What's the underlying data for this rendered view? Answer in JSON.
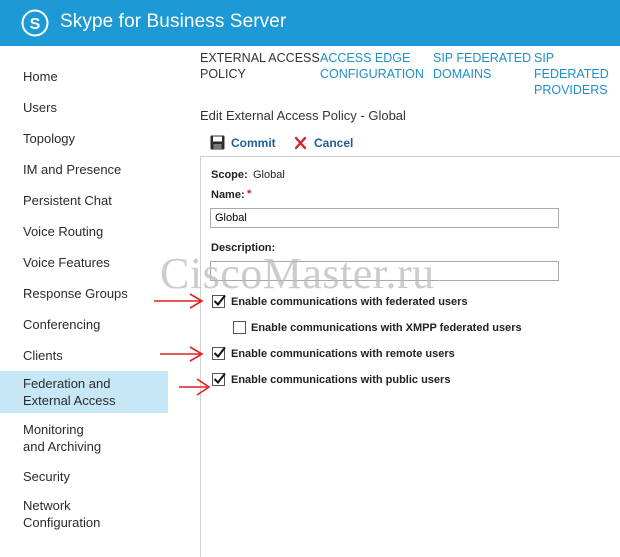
{
  "app": {
    "title": "Skype for Business Server"
  },
  "sidebar": {
    "items": [
      {
        "label": "Home"
      },
      {
        "label": "Users"
      },
      {
        "label": "Topology"
      },
      {
        "label": "IM and Presence"
      },
      {
        "label": "Persistent Chat"
      },
      {
        "label": "Voice Routing"
      },
      {
        "label": "Voice Features"
      },
      {
        "label": "Response Groups"
      },
      {
        "label": "Conferencing"
      },
      {
        "label": "Clients"
      },
      {
        "label": "Federation and\nExternal Access",
        "active": true
      },
      {
        "label": "Monitoring\nand Archiving"
      },
      {
        "label": "Security"
      },
      {
        "label": "Network\nConfiguration"
      }
    ]
  },
  "tabs": [
    {
      "label": "EXTERNAL ACCESS\nPOLICY",
      "active": true
    },
    {
      "label": "ACCESS EDGE\nCONFIGURATION"
    },
    {
      "label": "SIP FEDERATED\nDOMAINS"
    },
    {
      "label": "SIP FEDERATED\nPROVIDERS"
    }
  ],
  "page": {
    "title": "Edit External Access Policy - Global"
  },
  "toolbar": {
    "commit_label": "Commit",
    "cancel_label": "Cancel"
  },
  "form": {
    "scope_label": "Scope:",
    "scope_value": "Global",
    "name_label": "Name:",
    "name_required": "*",
    "name_value": "Global",
    "description_label": "Description:",
    "description_value": "",
    "checkboxes": [
      {
        "label": "Enable communications with federated users",
        "checked": true
      },
      {
        "label": "Enable communications with XMPP federated users",
        "checked": false
      },
      {
        "label": "Enable communications with remote users",
        "checked": true
      },
      {
        "label": "Enable communications with public users",
        "checked": true
      }
    ]
  },
  "watermark": "CiscoMaster.ru",
  "colors": {
    "topbar": "#1d9ad6",
    "active_nav": "#c7e6f6",
    "link": "#1e8fc8",
    "arrow": "#e02020"
  }
}
